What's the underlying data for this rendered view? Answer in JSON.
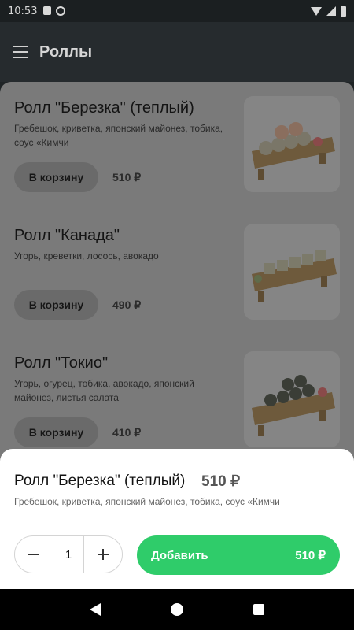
{
  "status_bar": {
    "time": "10:53"
  },
  "app_bar": {
    "title": "Роллы"
  },
  "products": [
    {
      "title": "Ролл \"Березка\" (теплый)",
      "description": "Гребешок, криветка, японский майонез, тобика, соус «Кимчи",
      "cart_label": "В корзину",
      "price": "510 ₽"
    },
    {
      "title": "Ролл \"Канада\"",
      "description": "Угорь, креветки, лосось, авокадо",
      "cart_label": "В корзину",
      "price": "490 ₽"
    },
    {
      "title": "Ролл \"Токио\"",
      "description": "Угорь, огурец, тобика, авокадо, японский майонез, листья салата",
      "cart_label": "В корзину",
      "price": "410 ₽"
    }
  ],
  "modal": {
    "title": "Ролл \"Березка\" (теплый)",
    "price": "510 ₽",
    "description": "Гребешок, криветка, японский майонез, тобика, соус «Кимчи",
    "quantity": "1",
    "minus_label": "−",
    "plus_label": "+",
    "add_label": "Добавить",
    "add_price": "510 ₽"
  },
  "colors": {
    "accent": "#2fcc6a"
  }
}
